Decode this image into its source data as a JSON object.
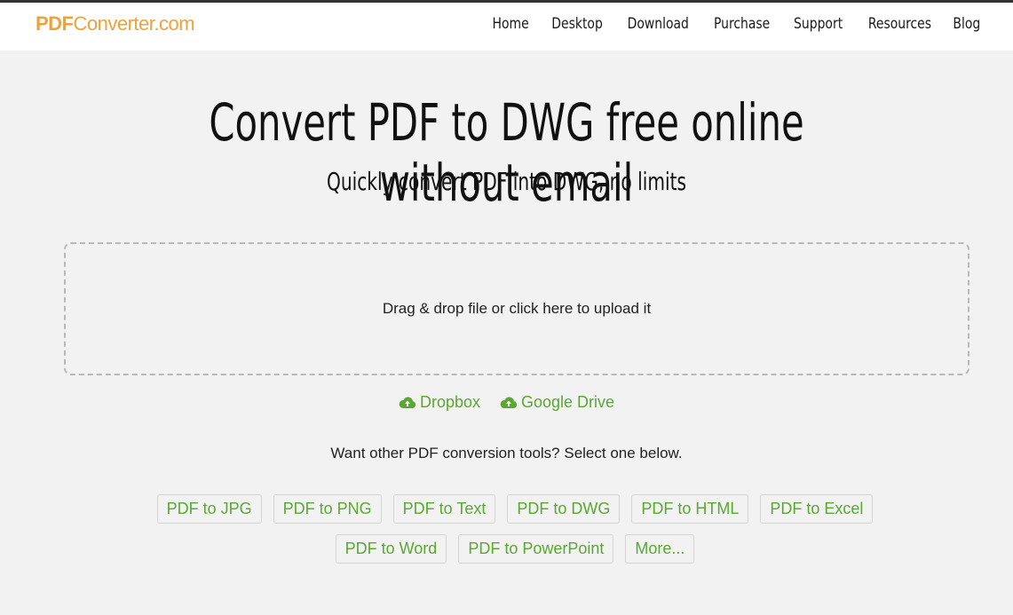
{
  "header": {
    "logo_pdf": "PDF",
    "logo_rest": "Converter.com",
    "nav": [
      "Home",
      "Desktop",
      "Download",
      "Purchase",
      "Support",
      "Resources",
      "Blog"
    ]
  },
  "hero": {
    "title": "Convert PDF to DWG free online without email",
    "subtitle": "Quickly convert PDF into DWG, no limits"
  },
  "upload": {
    "dropzone_text": "Drag & drop file or click here to upload it"
  },
  "cloud": {
    "dropbox": "Dropbox",
    "google_drive": "Google Drive",
    "icon": "cloud-upload-icon"
  },
  "tools": {
    "prompt": "Want other PDF conversion tools? Select one below.",
    "items": [
      "PDF to JPG",
      "PDF to PNG",
      "PDF to Text",
      "PDF to DWG",
      "PDF to HTML",
      "PDF to Excel",
      "PDF to Word",
      "PDF to PowerPoint",
      "More..."
    ]
  },
  "colors": {
    "accent": "#5aa832",
    "logo": "#f0a23a",
    "background": "#f2f2f2"
  }
}
